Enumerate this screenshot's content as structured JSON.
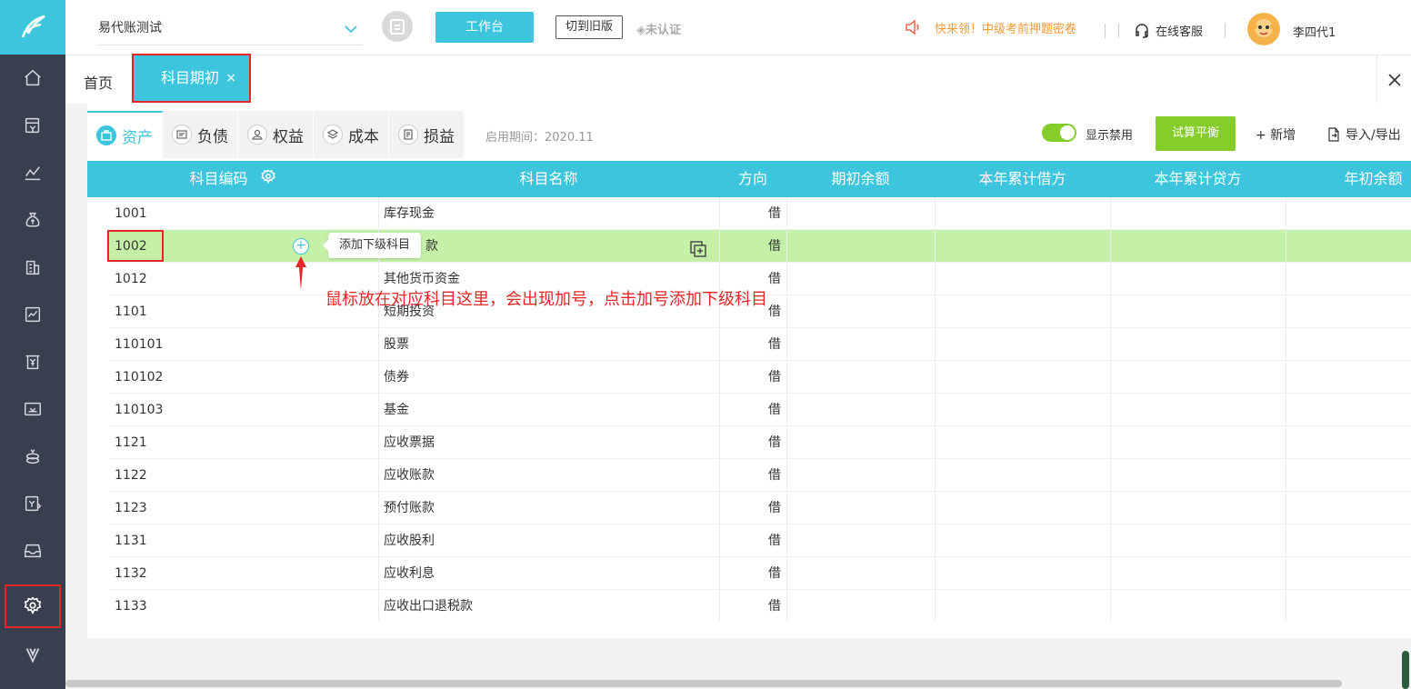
{
  "header": {
    "company": "易代账测试",
    "workbench_label": "工作台",
    "switch_old_label": "切到旧版",
    "cert_label": "未认证",
    "promo_text": "快来领！中级考前押题密卷",
    "service_label": "在线客服",
    "username": "李四代1"
  },
  "tabs": {
    "home": "首页",
    "active": "科目期初",
    "close_glyph": "×"
  },
  "subtabs": [
    {
      "label": "资产",
      "icon": "asset-icon"
    },
    {
      "label": "负债",
      "icon": "liability-icon"
    },
    {
      "label": "权益",
      "icon": "equity-icon"
    },
    {
      "label": "成本",
      "icon": "cost-icon"
    },
    {
      "label": "损益",
      "icon": "profit-loss-icon"
    }
  ],
  "toolbar": {
    "period": "启用期间：2020.11",
    "show_disabled": "显示禁用",
    "show_disabled_on": true,
    "trial_balance": "试算平衡",
    "add": "+ 新增",
    "import_export": "导入/导出"
  },
  "table": {
    "columns": [
      "科目编码",
      "科目名称",
      "方向",
      "期初余额",
      "本年累计借方",
      "本年累计贷方",
      "年初余额"
    ],
    "rows": [
      {
        "code": "1001",
        "name": "库存现金",
        "dir": "借"
      },
      {
        "code": "1002",
        "name": "款",
        "dir": "借"
      },
      {
        "code": "1012",
        "name": "其他货币资金",
        "dir": "借"
      },
      {
        "code": "1101",
        "name": "短期投资",
        "dir": "借"
      },
      {
        "code": "110101",
        "name": "股票",
        "dir": "借"
      },
      {
        "code": "110102",
        "name": "债券",
        "dir": "借"
      },
      {
        "code": "110103",
        "name": "基金",
        "dir": "借"
      },
      {
        "code": "1121",
        "name": "应收票据",
        "dir": "借"
      },
      {
        "code": "1122",
        "name": "应收账款",
        "dir": "借"
      },
      {
        "code": "1123",
        "name": "预付账款",
        "dir": "借"
      },
      {
        "code": "1131",
        "name": "应收股利",
        "dir": "借"
      },
      {
        "code": "1132",
        "name": "应收利息",
        "dir": "借"
      },
      {
        "code": "1133",
        "name": "应收出口退税款",
        "dir": "借"
      }
    ]
  },
  "tooltip": "添加下级科目",
  "annotation": "鼠标放在对应科目这里，会出现加号，点击加号添加下级科目",
  "colors": {
    "accent": "#3cc5dc",
    "green": "#85cd2a",
    "highlight_row": "#c4f0a8",
    "annotation": "#e52727"
  }
}
